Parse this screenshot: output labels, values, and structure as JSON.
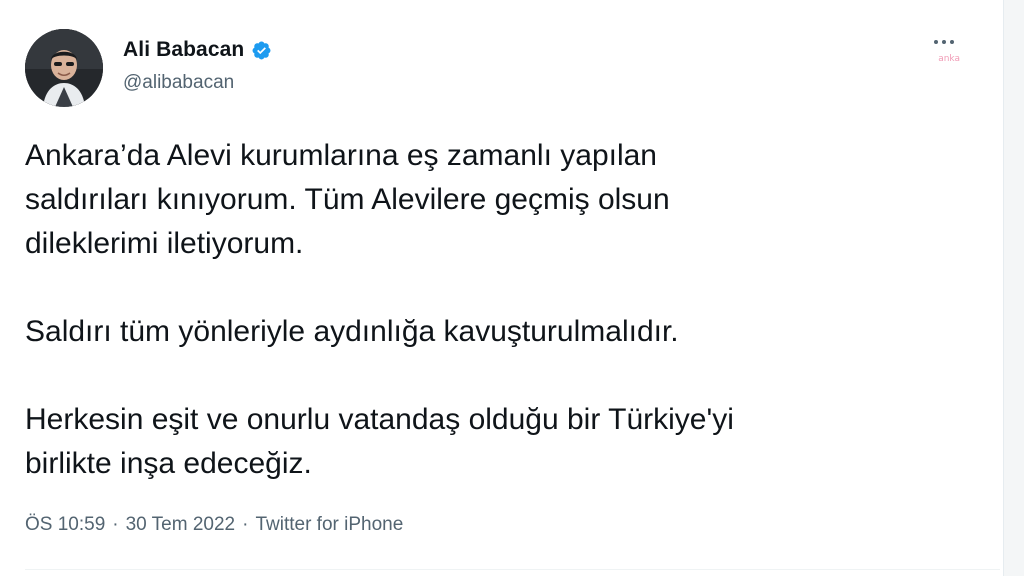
{
  "tweet": {
    "author": {
      "name": "Ali Babacan",
      "handle": "@alibabacan",
      "verified_color": "#1d9bf0"
    },
    "watermark": "anka",
    "paragraphs": [
      "Ankara’da Alevi kurumlarına eş zamanlı yapılan\nsaldırıları kınıyorum. Tüm Alevilere geçmiş olsun\ndileklerimi iletiyorum.",
      "Saldırı tüm yönleriyle aydınlığa kavuşturulmalıdır.",
      "Herkesin eşit ve onurlu vatandaş olduğu bir Türkiye'yi\nbirlikte inşa edeceğiz."
    ],
    "meta": {
      "time": "ÖS 10:59",
      "separator": "·",
      "date": "30 Tem 2022",
      "source": "Twitter for iPhone"
    }
  }
}
